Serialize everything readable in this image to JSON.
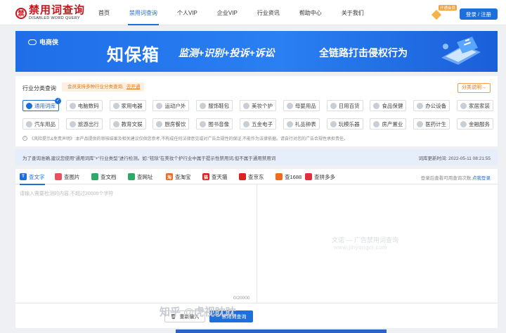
{
  "header": {
    "logo_mark": "禁",
    "logo_cn": "禁用词查询",
    "logo_en": "DISABLED WORD QUERY",
    "nav": [
      "首页",
      "禁用词查询",
      "个人VIP",
      "企业VIP",
      "行业资讯",
      "帮助中心",
      "关于我们"
    ],
    "active_nav": "禁用词查询",
    "vip_tag": "开通会员",
    "login_label": "登录 / 注册"
  },
  "banner": {
    "brand": "电商侠",
    "title": "知保箱",
    "slogan": "监测+识别+投诉+诉讼",
    "sub": "全链路打击侵权行为"
  },
  "categories": {
    "heading": "行业分类查询",
    "tip": "会员支持多种行业分类查询,",
    "tip_link": "去开通",
    "help": "分类说明→",
    "items": [
      {
        "label": "通用词库",
        "active": true
      },
      {
        "label": "电脑数码",
        "active": false
      },
      {
        "label": "家用电器",
        "active": false
      },
      {
        "label": "运动户外",
        "active": false
      },
      {
        "label": "服饰鞋包",
        "active": false
      },
      {
        "label": "美妆个护",
        "active": false
      },
      {
        "label": "母婴用品",
        "active": false
      },
      {
        "label": "日用百货",
        "active": false
      },
      {
        "label": "食品保健",
        "active": false
      },
      {
        "label": "办公设备",
        "active": false
      },
      {
        "label": "家居家装",
        "active": false
      },
      {
        "label": "汽车用品",
        "active": false
      },
      {
        "label": "旅游出行",
        "active": false
      },
      {
        "label": "教育文娱",
        "active": false
      },
      {
        "label": "厨房餐饮",
        "active": false
      },
      {
        "label": "图书音像",
        "active": false
      },
      {
        "label": "五金电子",
        "active": false
      },
      {
        "label": "礼品钟表",
        "active": false
      },
      {
        "label": "玩模乐器",
        "active": false
      },
      {
        "label": "房产置业",
        "active": false
      },
      {
        "label": "医药计生",
        "active": false
      },
      {
        "label": "金融服务",
        "active": false
      }
    ],
    "disclaimer": "《风险提示&免责声明》:本产品提供的审核结果及相关建议仅供您参考,不构成任何法律意见或对广告合规性的保证,不能作为法律依据。请自行对您的广告合规性承担责任。"
  },
  "notice": {
    "left": "为了查询准确,建议您使用“通用词库”+“行业类型”进行检测。如:“祛除”在美妆个护行业中属于提示性禁用词,但不属于通用禁用词",
    "right": "词库更新时间: 2022-05-11 08:21:55"
  },
  "editor": {
    "tabs": [
      {
        "label": "查文字",
        "color": "#1e6fd9",
        "glyph": "T"
      },
      {
        "label": "查图片",
        "color": "#e8505b",
        "glyph": ""
      },
      {
        "label": "查文档",
        "color": "#2fa86a",
        "glyph": ""
      },
      {
        "label": "查网址",
        "color": "#2fa86a",
        "glyph": ""
      },
      {
        "label": "查淘宝",
        "color": "#f26a1b",
        "glyph": "淘"
      },
      {
        "label": "查天猫",
        "color": "#d9231e",
        "glyph": "猫"
      },
      {
        "label": "查京东",
        "color": "#d9231e",
        "glyph": ""
      },
      {
        "label": "查1688",
        "color": "#f26a1b",
        "glyph": ""
      },
      {
        "label": "查拼多多",
        "color": "#e02e3c",
        "glyph": ""
      }
    ],
    "right_text": "登录后查看可用查询次数,",
    "right_link": "点我登录",
    "placeholder": "请输入需要检测的内容,不超过20000个字符",
    "counter": "0/20000",
    "watermark_cn": "文诺 — 广告禁用词查询",
    "watermark_url": "www.jinyongci.com",
    "watermark_zhihu": "知乎 @虎视眈眈",
    "reset_label": "重新输入",
    "query_label": "禁用词查询"
  }
}
